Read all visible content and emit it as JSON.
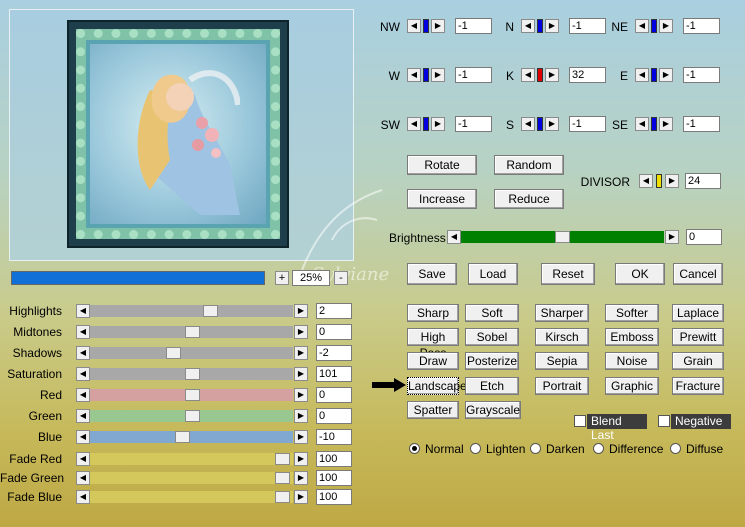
{
  "preview": {
    "zoom_value": "25%",
    "zoom_plus": "+",
    "zoom_minus": "-",
    "progress": 1.0,
    "watermark_text": "Sylviane"
  },
  "matrix": {
    "cells": [
      {
        "label": "NW",
        "value": "-1",
        "color": "#0000e0"
      },
      {
        "label": "N",
        "value": "-1",
        "color": "#0000e0"
      },
      {
        "label": "NE",
        "value": "-1",
        "color": "#0000e0"
      },
      {
        "label": "W",
        "value": "-1",
        "color": "#0000e0"
      },
      {
        "label": "K",
        "value": "32",
        "color": "#e00000"
      },
      {
        "label": "E",
        "value": "-1",
        "color": "#0000e0"
      },
      {
        "label": "SW",
        "value": "-1",
        "color": "#0000e0"
      },
      {
        "label": "S",
        "value": "-1",
        "color": "#0000e0"
      },
      {
        "label": "SE",
        "value": "-1",
        "color": "#0000e0"
      }
    ],
    "rotate_label": "Rotate",
    "random_label": "Random",
    "increase_label": "Increase",
    "reduce_label": "Reduce",
    "divisor": {
      "label": "DIVISOR",
      "value": "24",
      "color": "#f0e000"
    }
  },
  "brightness": {
    "label": "Brightness",
    "value": "0",
    "fill_color": "#008000"
  },
  "actions": {
    "save": "Save",
    "load": "Load",
    "reset": "Reset",
    "ok": "OK",
    "cancel": "Cancel"
  },
  "presets": [
    [
      "Sharp",
      "Soft",
      "Sharper",
      "Softer",
      "Laplace"
    ],
    [
      "High Pass",
      "Sobel",
      "Kirsch",
      "Emboss",
      "Prewitt"
    ],
    [
      "Draw",
      "Posterize",
      "Sepia",
      "Noise",
      "Grain"
    ],
    [
      "Landscape",
      "Etch",
      "Portrait",
      "Graphic",
      "Fracture"
    ],
    [
      "Spatter",
      "Grayscale"
    ]
  ],
  "options": {
    "blend_last": "Blend Last",
    "negative": "Negative"
  },
  "blend_modes": {
    "selected": "Normal",
    "items": [
      "Normal",
      "Lighten",
      "Darken",
      "Difference",
      "Diffuse"
    ]
  },
  "adjust": [
    {
      "label": "Highlights",
      "value": "2",
      "track": "#a8a8a8"
    },
    {
      "label": "Midtones",
      "value": "0",
      "track": "#a8a8a8"
    },
    {
      "label": "Shadows",
      "value": "-2",
      "track": "#a8a8a8"
    },
    {
      "label": "Saturation",
      "value": "101",
      "track": "#a8a8a8"
    },
    {
      "label": "Red",
      "value": "0",
      "track": "#d4a0a0"
    },
    {
      "label": "Green",
      "value": "0",
      "track": "#98c890"
    },
    {
      "label": "Blue",
      "value": "-10",
      "track": "#80a8d0"
    },
    {
      "label": "Fade Red",
      "value": "100",
      "track": "#d4c85c"
    },
    {
      "label": "Fade Green",
      "value": "100",
      "track": "#d4c85c"
    },
    {
      "label": "Fade Blue",
      "value": "100",
      "track": "#d4c85c"
    }
  ]
}
